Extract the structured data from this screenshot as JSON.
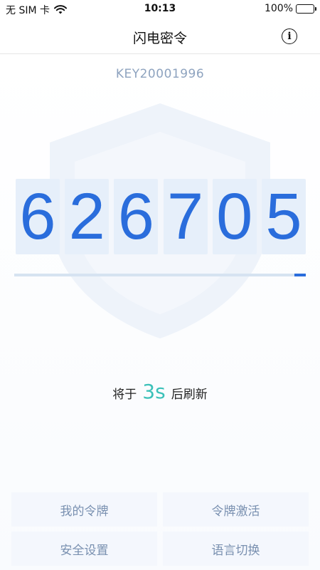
{
  "status_bar": {
    "carrier": "无 SIM 卡",
    "time": "10:13",
    "battery_percent": "100%",
    "battery_level": 1.0,
    "battery_color": "#38c95b"
  },
  "nav": {
    "title": "闪电密令",
    "info_glyph": "i"
  },
  "token": {
    "key_id": "KEY20001996",
    "digits": [
      "6",
      "2",
      "6",
      "7",
      "0",
      "5"
    ],
    "progress_remaining": 0.04,
    "refresh_prefix": "将于",
    "refresh_seconds": "3s",
    "refresh_suffix": "后刷新"
  },
  "menu": {
    "my_tokens": "我的令牌",
    "activate_token": "令牌激活",
    "security_settings": "安全设置",
    "language_switch": "语言切换"
  },
  "colors": {
    "accent": "#2a6ddc",
    "seconds": "#3cc1b9",
    "digit_bg": "#e6effa",
    "menu_text": "#7990b0"
  }
}
